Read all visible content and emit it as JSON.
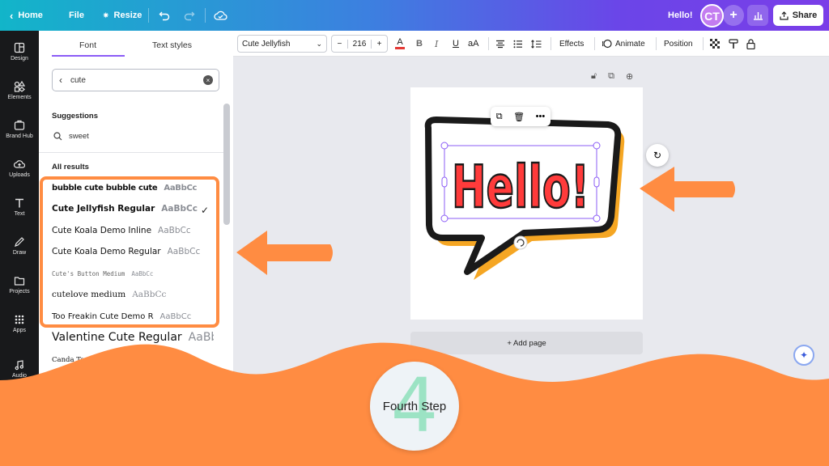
{
  "topbar": {
    "home_label": "Home",
    "file_label": "File",
    "resize_label": "Resize",
    "greeting": "Hello!",
    "avatar_initials": "CT",
    "share_label": "Share"
  },
  "rail": [
    {
      "label": "Design",
      "icon": "layout-icon"
    },
    {
      "label": "Elements",
      "icon": "shapes-icon"
    },
    {
      "label": "Brand Hub",
      "icon": "brand-icon"
    },
    {
      "label": "Uploads",
      "icon": "cloud-upload-icon"
    },
    {
      "label": "Text",
      "icon": "text-icon"
    },
    {
      "label": "Draw",
      "icon": "pen-icon"
    },
    {
      "label": "Projects",
      "icon": "folder-icon"
    },
    {
      "label": "Apps",
      "icon": "apps-grid-icon"
    },
    {
      "label": "Audio",
      "icon": "music-icon"
    }
  ],
  "panel": {
    "tab_font": "Font",
    "tab_text_styles": "Text styles",
    "search_value": "cute",
    "suggestions_title": "Suggestions",
    "suggestion": "sweet",
    "all_results_title": "All results",
    "fonts": [
      {
        "name": "bubble cute bubble cute",
        "sample": "AaBbCc"
      },
      {
        "name": "Cute Jellyfish Regular",
        "sample": "AaBbCc"
      },
      {
        "name": "Cute Koala Demo Inline",
        "sample": "AaBbCc"
      },
      {
        "name": "Cute Koala Demo Regular",
        "sample": "AaBbCc"
      },
      {
        "name": "Cute's Button Medium",
        "sample": "AaBbCc"
      },
      {
        "name": "cutelove medium",
        "sample": "AaBbCc"
      },
      {
        "name": "Too Freakin Cute Demo R",
        "sample": "AaBbCc"
      },
      {
        "name": "Valentine Cute Regular",
        "sample": "AaBbCc"
      },
      {
        "name": "Canda Tawa Cute",
        "sample": ""
      }
    ]
  },
  "toolbar": {
    "font_name": "Cute Jellyfish",
    "font_size": "216",
    "effects_label": "Effects",
    "animate_label": "Animate",
    "position_label": "Position"
  },
  "canvas": {
    "bubble_text": "Hello!",
    "add_page_label": "+ Add page"
  },
  "overlay": {
    "step_number": "4",
    "step_label": "Fourth Step",
    "accent_color": "#ff8c42"
  }
}
